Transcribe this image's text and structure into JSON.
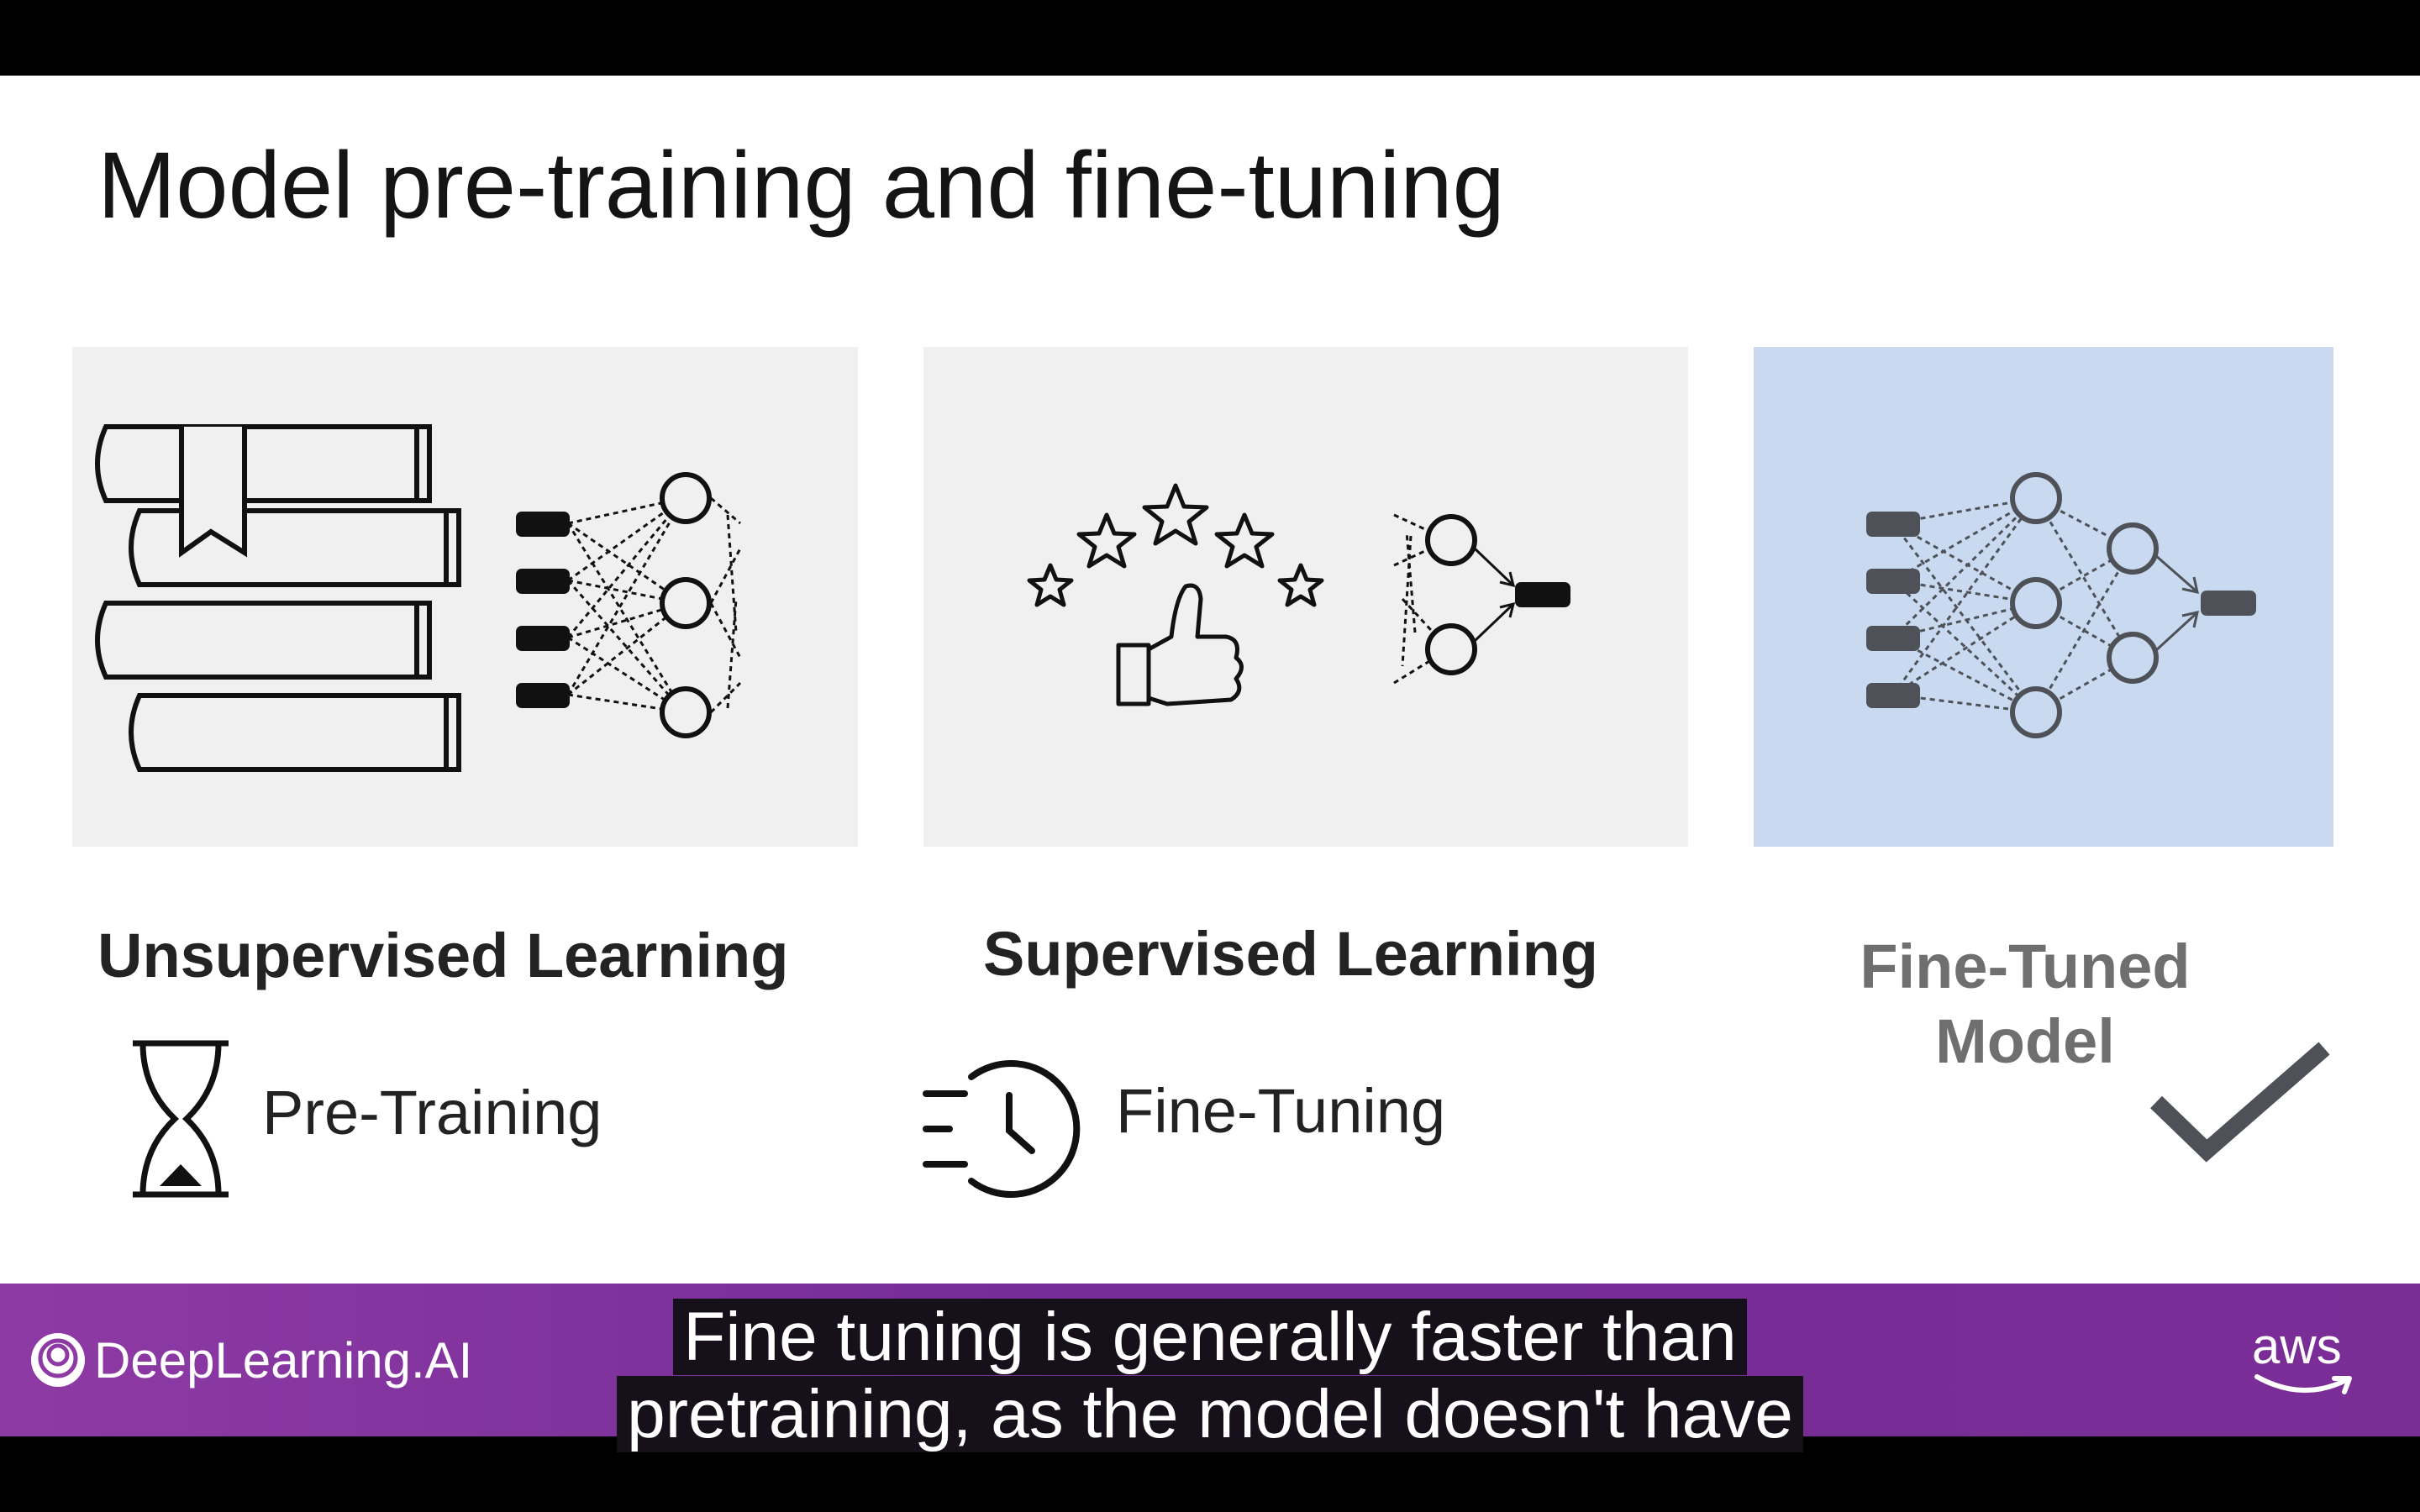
{
  "slide": {
    "title": "Model pre-training and fine-tuning",
    "panels": [
      {
        "id": "pretraining",
        "heading": "Unsupervised Learning",
        "sub_label": "Pre-Training",
        "sub_icon": "hourglass-icon"
      },
      {
        "id": "finetuning",
        "heading": "Supervised Learning",
        "sub_label": "Fine-Tuning",
        "sub_icon": "fast-clock-icon"
      },
      {
        "id": "result",
        "heading_line1": "Fine-Tuned",
        "heading_line2": "Model",
        "sub_icon": "checkmark-icon"
      }
    ]
  },
  "footer": {
    "brand": "DeepLearning.AI",
    "partner": "aws"
  },
  "caption": {
    "line1": "Fine tuning is generally faster than",
    "line2": "pretraining, as the model doesn't have"
  },
  "colors": {
    "panel_grey": "#f0f0f0",
    "panel_blue": "#c8d9f0",
    "footer_purple": "#7b2d96"
  }
}
